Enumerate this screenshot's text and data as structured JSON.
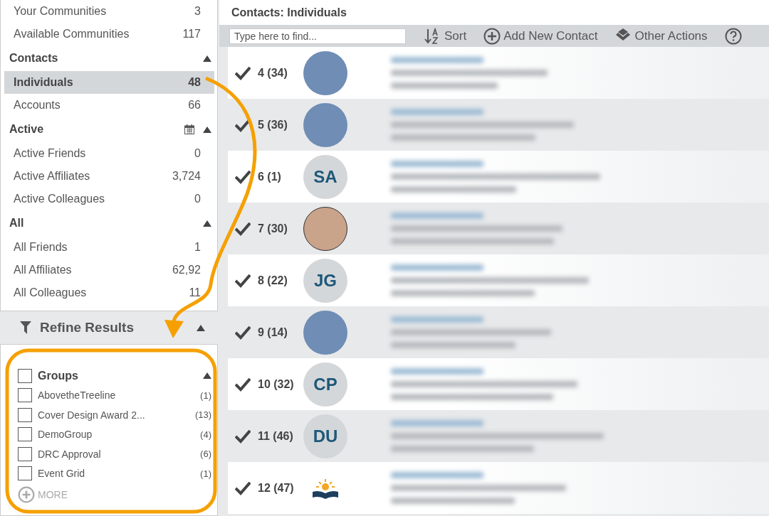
{
  "sidebar": {
    "sections": [
      {
        "items": [
          {
            "label": "Your Communities",
            "count": "3",
            "selected": false
          },
          {
            "label": "Available Communities",
            "count": "117",
            "selected": false
          }
        ]
      },
      {
        "title": "Contacts",
        "calendar": false,
        "items": [
          {
            "label": "Individuals",
            "count": "48",
            "selected": true
          },
          {
            "label": "Accounts",
            "count": "66",
            "selected": false
          }
        ]
      },
      {
        "title": "Active",
        "calendar": true,
        "items": [
          {
            "label": "Active Friends",
            "count": "0",
            "selected": false
          },
          {
            "label": "Active Affiliates",
            "count": "3,724",
            "selected": false
          },
          {
            "label": "Active Colleagues",
            "count": "0",
            "selected": false
          }
        ]
      },
      {
        "title": "All",
        "calendar": false,
        "items": [
          {
            "label": "All Friends",
            "count": "1",
            "selected": false
          },
          {
            "label": "All Affiliates",
            "count": "62,92",
            "selected": false
          },
          {
            "label": "All Colleagues",
            "count": "11",
            "selected": false
          }
        ]
      }
    ]
  },
  "refine": {
    "title": "Refine Results",
    "groups_header": {
      "label": "Groups",
      "checked": false
    },
    "groups": [
      {
        "label": "AbovetheTreeline",
        "count": "(1)",
        "checked": false
      },
      {
        "label": "Cover Design Award 2...",
        "count": "(13)",
        "checked": false
      },
      {
        "label": "DemoGroup",
        "count": "(4)",
        "checked": false
      },
      {
        "label": "DRC Approval",
        "count": "(6)",
        "checked": false
      },
      {
        "label": "Event Grid",
        "count": "(1)",
        "checked": false
      }
    ],
    "more": "MORE"
  },
  "main": {
    "title": "Contacts: Individuals",
    "search": {
      "placeholder": "Type here to find..."
    },
    "actions": [
      {
        "kind": "sort",
        "label": "Sort"
      },
      {
        "kind": "add",
        "label": "Add New Contact"
      },
      {
        "kind": "other",
        "label": "Other Actions"
      },
      {
        "kind": "help"
      }
    ],
    "contacts": [
      {
        "number": "4 (34)",
        "checked": true,
        "avatar": {
          "kind": "photo"
        }
      },
      {
        "number": "5 (36)",
        "checked": true,
        "avatar": {
          "kind": "photo"
        }
      },
      {
        "number": "6 (1)",
        "checked": true,
        "avatar": {
          "kind": "initials",
          "initials": "SA"
        }
      },
      {
        "number": "7 (30)",
        "checked": true,
        "avatar": {
          "kind": "cartoon"
        }
      },
      {
        "number": "8 (22)",
        "checked": true,
        "avatar": {
          "kind": "initials",
          "initials": "JG"
        }
      },
      {
        "number": "9 (14)",
        "checked": true,
        "avatar": {
          "kind": "photo"
        }
      },
      {
        "number": "10 (32)",
        "checked": true,
        "avatar": {
          "kind": "initials",
          "initials": "CP"
        }
      },
      {
        "number": "11 (46)",
        "checked": true,
        "avatar": {
          "kind": "initials",
          "initials": "DU"
        }
      },
      {
        "number": "12 (47)",
        "checked": true,
        "avatar": {
          "kind": "logo"
        }
      }
    ]
  },
  "annotations": {
    "arrow": true,
    "highlight": true
  }
}
